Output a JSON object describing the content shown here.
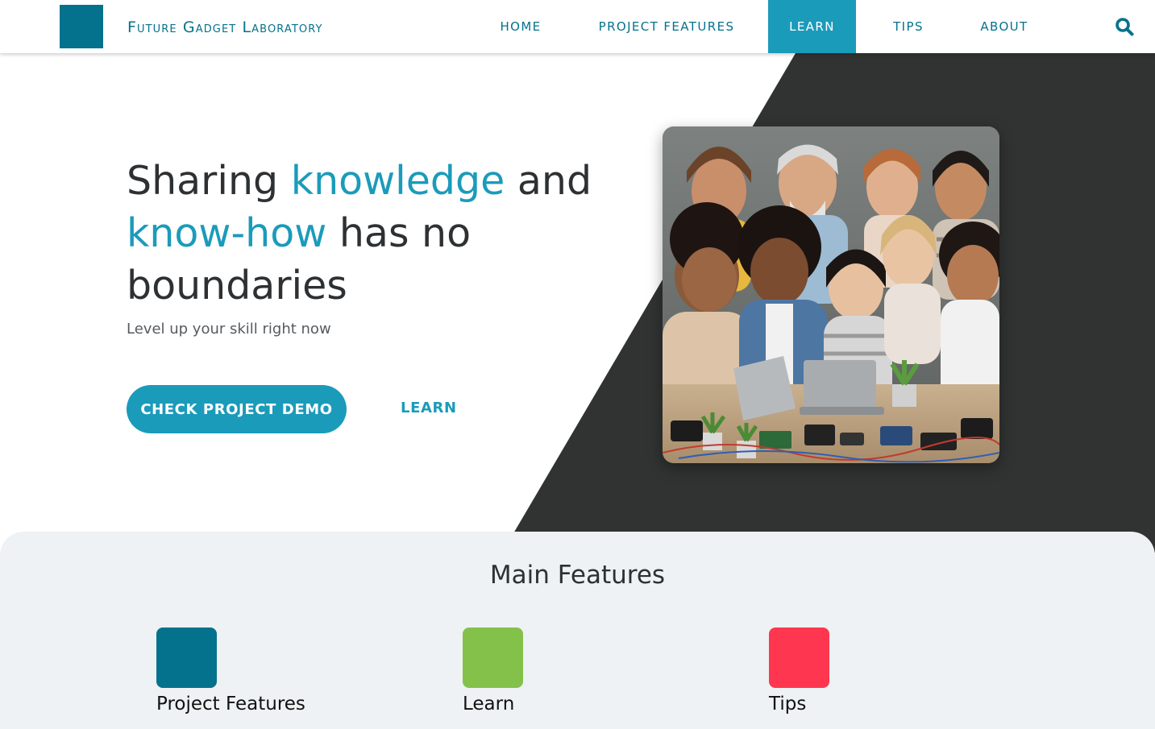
{
  "header": {
    "brand": "Future Gadget Laboratory",
    "nav": [
      {
        "label": "HOME",
        "active": false
      },
      {
        "label": "PROJECT FEATURES",
        "active": false
      },
      {
        "label": "LEARN",
        "active": true
      },
      {
        "label": "TIPS",
        "active": false
      },
      {
        "label": "ABOUT",
        "active": false
      }
    ],
    "search_icon": "search-icon"
  },
  "hero": {
    "headline": {
      "part1": "Sharing ",
      "accent1": "knowledge",
      "part2": " and ",
      "accent2": "know-how",
      "part3": " has no boundaries"
    },
    "subline": "Level up your skill right now",
    "cta_label": "CHECK PROJECT DEMO",
    "secondary_label": "LEARN",
    "image_icon": "group-photo"
  },
  "features": {
    "title": "Main Features",
    "items": [
      {
        "label": "Project Features",
        "color": "#04728c"
      },
      {
        "label": "Learn",
        "color": "#84c14a"
      },
      {
        "label": "Tips",
        "color": "#ff364f"
      }
    ]
  },
  "colors": {
    "brand": "#04728c",
    "accent": "#1b9bba",
    "dark_panel": "#303332",
    "features_bg": "#eef2f4"
  }
}
